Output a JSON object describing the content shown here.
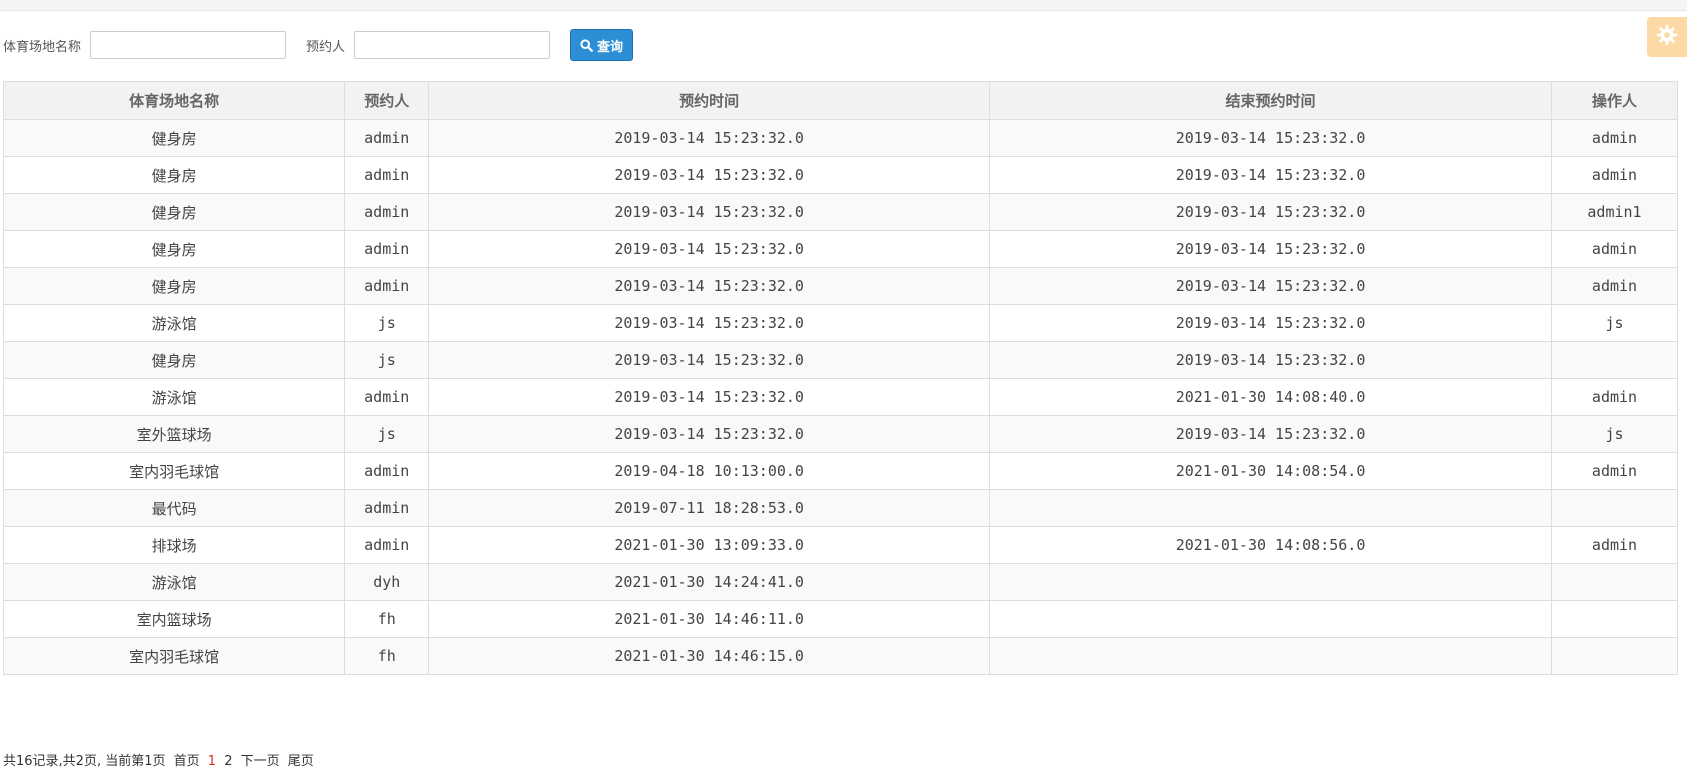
{
  "search": {
    "venue_label": "体育场地名称",
    "venue_value": "",
    "booker_label": "预约人",
    "booker_value": "",
    "query_label": "查询"
  },
  "table": {
    "headers": [
      "体育场地名称",
      "预约人",
      "预约时间",
      "结束预约时间",
      "操作人"
    ],
    "rows": [
      [
        "健身房",
        "admin",
        "2019-03-14 15:23:32.0",
        "2019-03-14 15:23:32.0",
        "admin"
      ],
      [
        "健身房",
        "admin",
        "2019-03-14 15:23:32.0",
        "2019-03-14 15:23:32.0",
        "admin"
      ],
      [
        "健身房",
        "admin",
        "2019-03-14 15:23:32.0",
        "2019-03-14 15:23:32.0",
        "admin1"
      ],
      [
        "健身房",
        "admin",
        "2019-03-14 15:23:32.0",
        "2019-03-14 15:23:32.0",
        "admin"
      ],
      [
        "健身房",
        "admin",
        "2019-03-14 15:23:32.0",
        "2019-03-14 15:23:32.0",
        "admin"
      ],
      [
        "游泳馆",
        "js",
        "2019-03-14 15:23:32.0",
        "2019-03-14 15:23:32.0",
        "js"
      ],
      [
        "健身房",
        "js",
        "2019-03-14 15:23:32.0",
        "2019-03-14 15:23:32.0",
        ""
      ],
      [
        "游泳馆",
        "admin",
        "2019-03-14 15:23:32.0",
        "2021-01-30 14:08:40.0",
        "admin"
      ],
      [
        "室外篮球场",
        "js",
        "2019-03-14 15:23:32.0",
        "2019-03-14 15:23:32.0",
        "js"
      ],
      [
        "室内羽毛球馆",
        "admin",
        "2019-04-18 10:13:00.0",
        "2021-01-30 14:08:54.0",
        "admin"
      ],
      [
        "最代码",
        "admin",
        "2019-07-11 18:28:53.0",
        "",
        ""
      ],
      [
        "排球场",
        "admin",
        "2021-01-30 13:09:33.0",
        "2021-01-30 14:08:56.0",
        "admin"
      ],
      [
        "游泳馆",
        "dyh",
        "2021-01-30 14:24:41.0",
        "",
        ""
      ],
      [
        "室内篮球场",
        "fh",
        "2021-01-30 14:46:11.0",
        "",
        ""
      ],
      [
        "室内羽毛球馆",
        "fh",
        "2021-01-30 14:46:15.0",
        "",
        ""
      ]
    ]
  },
  "pager": {
    "summary": "共16记录,共2页, 当前第1页",
    "first": "首页",
    "page1": "1",
    "page2": "2",
    "next": "下一页",
    "last": "尾页"
  },
  "colors": {
    "accent": "#2c8fd6",
    "gear_bg": "#fcd9a5",
    "active_page": "#e0301e"
  },
  "icons": {
    "query": "search-icon",
    "settings": "gear-icon"
  }
}
